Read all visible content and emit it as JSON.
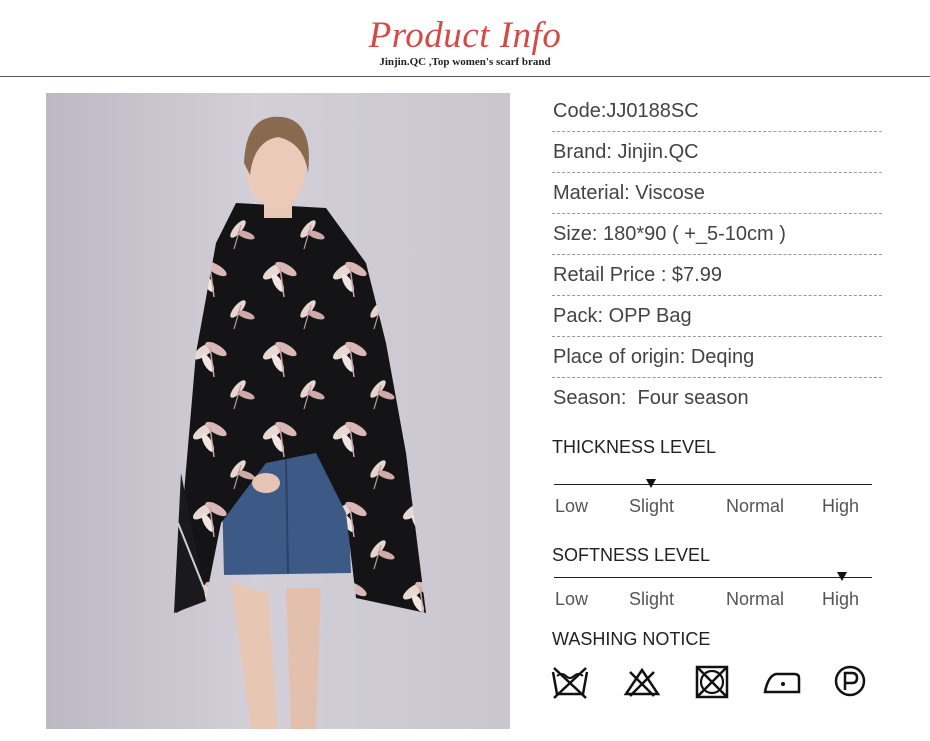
{
  "header": {
    "title": "Product Info",
    "subtitle": "Jinjin.QC ,Top women's scarf brand"
  },
  "specs": [
    {
      "text": "Code:JJ0188SC"
    },
    {
      "text": "Brand: Jinjin.QC"
    },
    {
      "text": "Material: Viscose"
    },
    {
      "text": "Size: 180*90 ( +_5-10cm )"
    },
    {
      "text": "Retail Price : $7.99"
    },
    {
      "text": "Pack: OPP Bag"
    },
    {
      "text": "Place of origin: Deqing"
    },
    {
      "text": "Season:  Four season"
    }
  ],
  "thickness": {
    "title": "THICKNESS LEVEL",
    "labels": [
      "Low",
      "Slight",
      "Normal",
      "High"
    ],
    "selected": "Slight"
  },
  "softness": {
    "title": "SOFTNESS LEVEL",
    "labels": [
      "Low",
      "Slight",
      "Normal",
      "High"
    ],
    "selected": "High"
  },
  "washing": {
    "title": "WASHING NOTICE",
    "icons": [
      "do-not-wash-icon",
      "do-not-bleach-icon",
      "do-not-tumble-dry-icon",
      "low-heat-iron-icon",
      "dry-clean-p-icon"
    ]
  },
  "photo": {
    "icon": "model-wearing-scarf-photo"
  }
}
